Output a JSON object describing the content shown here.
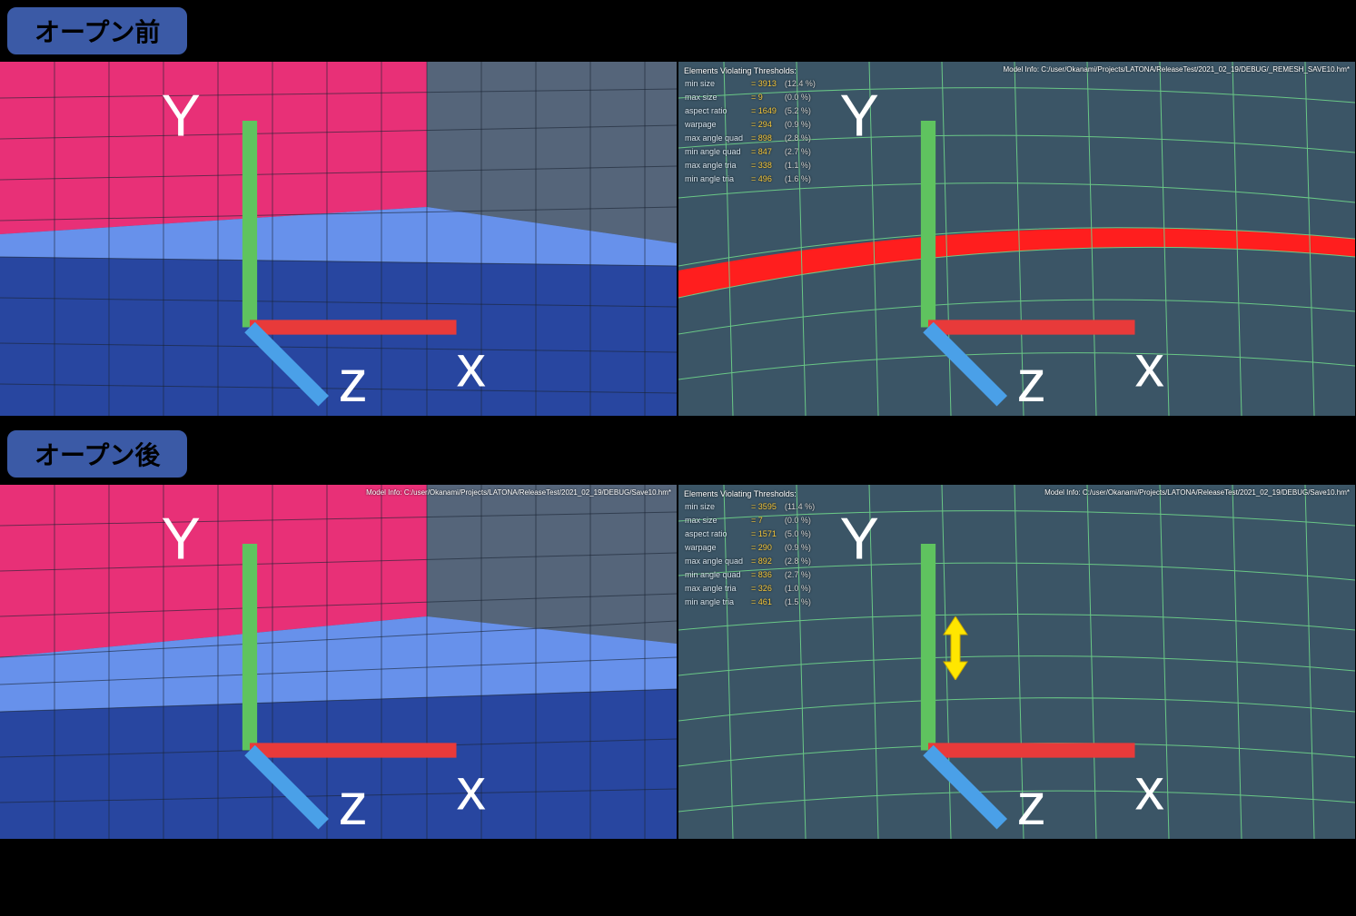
{
  "labels": {
    "before": "オープン前",
    "after": "オープン後"
  },
  "model_info": {
    "before_right": "Model Info: C:/user/Okanami/Projects/LATONA/ReleaseTest/2021_02_19/DEBUG/_REMESH_SAVE10.hm*",
    "after_left": "Model Info: C:/user/Okanami/Projects/LATONA/ReleaseTest/2021_02_19/DEBUG/Save10.hm*",
    "after_right": "Model Info: C:/user/Okanami/Projects/LATONA/ReleaseTest/2021_02_19/DEBUG/Save10.hm*"
  },
  "stats_header": "Elements Violating Thresholds:",
  "stats_before": [
    {
      "label": "min size",
      "value": "= 3913",
      "pct": "(12.4 %)"
    },
    {
      "label": "max size",
      "value": "= 9",
      "pct": "(0.0 %)"
    },
    {
      "label": "aspect ratio",
      "value": "= 1649",
      "pct": "(5.2 %)"
    },
    {
      "label": "warpage",
      "value": "= 294",
      "pct": "(0.9 %)"
    },
    {
      "label": "max angle quad",
      "value": "= 898",
      "pct": "(2.8 %)"
    },
    {
      "label": "min angle quad",
      "value": "= 847",
      "pct": "(2.7 %)"
    },
    {
      "label": "max angle tria",
      "value": "= 338",
      "pct": "(1.1 %)"
    },
    {
      "label": "min angle tria",
      "value": "= 496",
      "pct": "(1.6 %)"
    }
  ],
  "stats_after": [
    {
      "label": "min size",
      "value": "= 3595",
      "pct": "(11.4 %)"
    },
    {
      "label": "max size",
      "value": "= 7",
      "pct": "(0.0 %)"
    },
    {
      "label": "aspect ratio",
      "value": "= 1571",
      "pct": "(5.0 %)"
    },
    {
      "label": "warpage",
      "value": "= 290",
      "pct": "(0.9 %)"
    },
    {
      "label": "max angle quad",
      "value": "= 892",
      "pct": "(2.8 %)"
    },
    {
      "label": "min angle quad",
      "value": "= 836",
      "pct": "(2.7 %)"
    },
    {
      "label": "max angle tria",
      "value": "= 326",
      "pct": "(1.0 %)"
    },
    {
      "label": "min angle tria",
      "value": "= 461",
      "pct": "(1.5 %)"
    }
  ],
  "triad": {
    "x": "x",
    "y": "Y",
    "z": "z"
  }
}
